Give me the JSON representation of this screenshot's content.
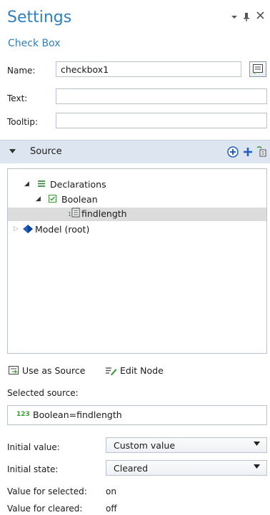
{
  "header": {
    "title": "Settings",
    "subtitle": "Check Box",
    "controls": [
      "▾",
      "⬛",
      "✕"
    ]
  },
  "form": {
    "name_label": "Name:",
    "name_value": "checkbox1",
    "text_label": "Text:",
    "text_value": "",
    "tooltip_label": "Tooltip:",
    "tooltip_value": ""
  },
  "source_section": {
    "label": "Source"
  },
  "tree": {
    "items": [
      {
        "label": "Declarations",
        "expanded": true
      },
      {
        "label": "Boolean",
        "expanded": true
      },
      {
        "label": "findlength",
        "selected": true
      },
      {
        "label": "Model (root)",
        "expanded": false
      }
    ]
  },
  "actions": {
    "use_as_source": "Use as Source",
    "edit_node": "Edit Node"
  },
  "selected_source": {
    "label": "Selected source:",
    "prefix": "123",
    "value": "Boolean=findlength"
  },
  "settings": {
    "initial_value_label": "Initial value:",
    "initial_value": "Custom value",
    "initial_state_label": "Initial state:",
    "initial_state": "Cleared",
    "value_selected_label": "Value for selected:",
    "value_selected": "on",
    "value_cleared_label": "Value for cleared:",
    "value_cleared": "off"
  },
  "colors": {
    "accent": "#2f7fc1",
    "section_bg": "#dde6f0",
    "icon_blue": "#1f5fbf",
    "icon_green": "#3a9a3a"
  }
}
